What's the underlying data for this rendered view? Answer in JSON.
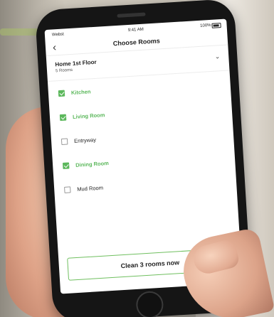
{
  "status": {
    "carrier": "Webst",
    "time": "9:41 AM",
    "battery": "100%"
  },
  "nav": {
    "title": "Choose Rooms"
  },
  "floor": {
    "name": "Home 1st Floor",
    "subtitle": "5 Rooms"
  },
  "rooms": [
    {
      "label": "Kitchen",
      "checked": true
    },
    {
      "label": "Living Room",
      "checked": true
    },
    {
      "label": "Entryway",
      "checked": false
    },
    {
      "label": "Dining Room",
      "checked": true
    },
    {
      "label": "Mud Room",
      "checked": false
    }
  ],
  "action": {
    "clean_label": "Clean 3 rooms now"
  },
  "colors": {
    "accent": "#5cb85c"
  },
  "icons": {
    "back": "chevron-left-icon",
    "dropdown": "chevron-down-icon",
    "wifi": "wifi-icon",
    "battery": "battery-icon"
  }
}
